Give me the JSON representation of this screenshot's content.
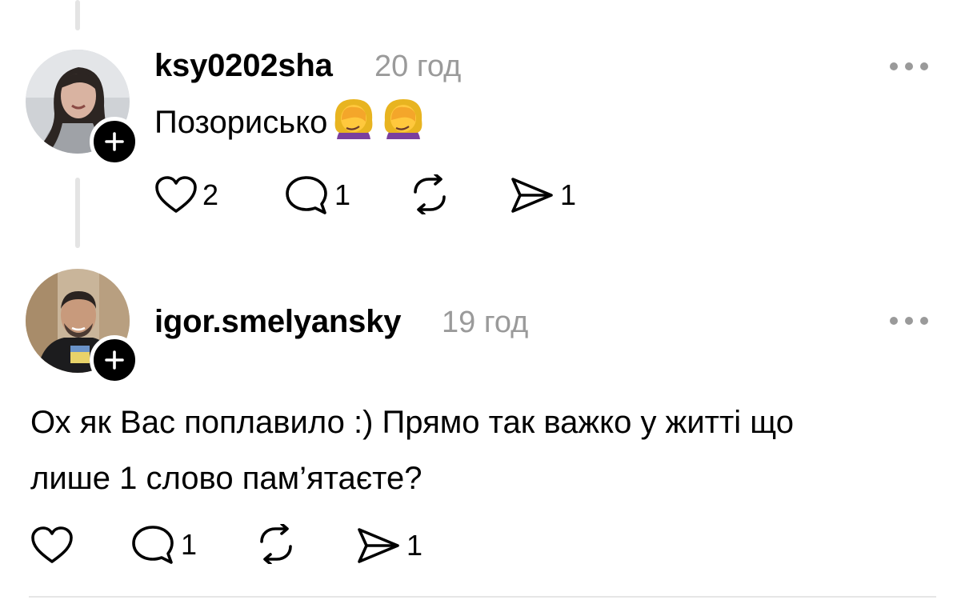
{
  "comments": [
    {
      "username": "ksy0202sha",
      "time": "20 год",
      "text": "Позорисько",
      "emojis": [
        "woman-facepalming",
        "woman-facepalming"
      ],
      "likes": "2",
      "replies": "1",
      "reposts": "",
      "shares": "1"
    },
    {
      "username": "igor.smelyansky",
      "time": "19 год",
      "text_line1": "Ох як Вас поплавило :) Прямо так важко у житті що",
      "text_line2": "лише 1 слово пам’ятаєте?",
      "likes": "",
      "replies": "1",
      "reposts": "",
      "shares": "1"
    }
  ],
  "icons": {
    "like": "heart-icon",
    "reply": "comment-bubble-icon",
    "repost": "repost-icon",
    "share": "send-icon",
    "more": "more-dots-icon",
    "follow": "plus-icon"
  }
}
